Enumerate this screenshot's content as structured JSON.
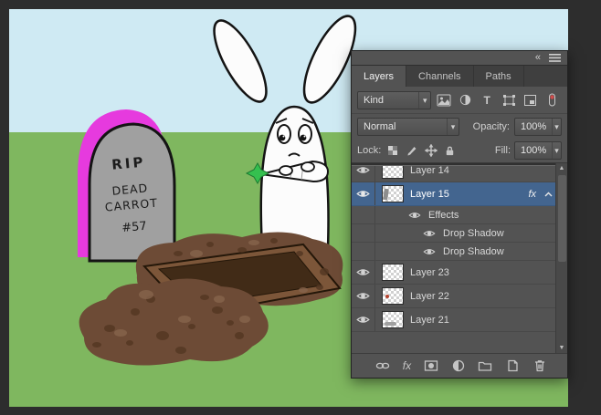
{
  "artwork": {
    "gravestone": {
      "line1": "RIP",
      "line2": "DEAD",
      "line3": "CARROT",
      "line4": "#57"
    }
  },
  "layers_panel": {
    "tabs": [
      "Layers",
      "Channels",
      "Paths"
    ],
    "active_tab": "Layers",
    "kind_filter": "Kind",
    "blend_mode": "Normal",
    "opacity_label": "Opacity:",
    "opacity_value": "100%",
    "lock_label": "Lock:",
    "fill_label": "Fill:",
    "fill_value": "100%",
    "fx_badge": "fx",
    "bottom_bar_fx": "fx",
    "rows": [
      {
        "name": "Layer 14",
        "type": "layer",
        "visible": true
      },
      {
        "name": "Layer 15",
        "type": "layer",
        "visible": true,
        "selected": true,
        "has_effects": true
      },
      {
        "name": "Effects",
        "type": "effects-group",
        "visible": true
      },
      {
        "name": "Drop Shadow",
        "type": "effect",
        "visible": true
      },
      {
        "name": "Drop Shadow",
        "type": "effect",
        "visible": true
      },
      {
        "name": "Layer 23",
        "type": "layer",
        "visible": true
      },
      {
        "name": "Layer 22",
        "type": "layer",
        "visible": true
      },
      {
        "name": "Layer 21",
        "type": "layer",
        "visible": true
      }
    ]
  },
  "icons": {
    "collapse": "«",
    "dropdown_arrow": "▾",
    "type_filter": "T",
    "scroll_up": "▲",
    "scroll_down": "▼"
  },
  "colors": {
    "sky": "#cfeaf3",
    "grass": "#7fb75f",
    "aura_magenta": "#e63ade",
    "selection_blue": "#43658f",
    "panel_bg": "#535353"
  }
}
